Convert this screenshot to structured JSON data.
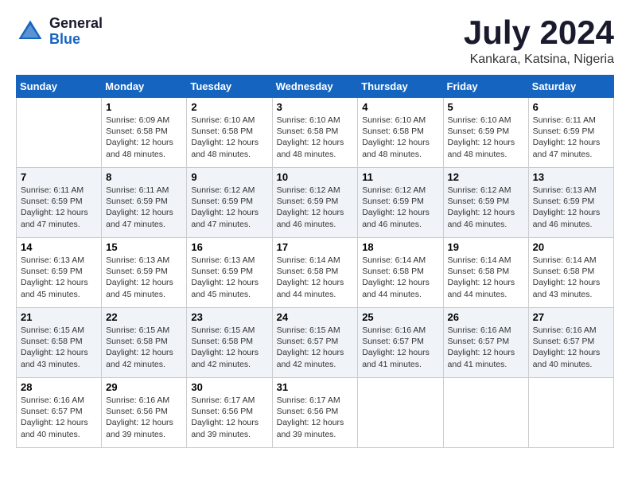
{
  "header": {
    "logo_general": "General",
    "logo_blue": "Blue",
    "month_title": "July 2024",
    "location": "Kankara, Katsina, Nigeria"
  },
  "days_of_week": [
    "Sunday",
    "Monday",
    "Tuesday",
    "Wednesday",
    "Thursday",
    "Friday",
    "Saturday"
  ],
  "weeks": [
    [
      {
        "num": "",
        "info": ""
      },
      {
        "num": "1",
        "info": "Sunrise: 6:09 AM\nSunset: 6:58 PM\nDaylight: 12 hours\nand 48 minutes."
      },
      {
        "num": "2",
        "info": "Sunrise: 6:10 AM\nSunset: 6:58 PM\nDaylight: 12 hours\nand 48 minutes."
      },
      {
        "num": "3",
        "info": "Sunrise: 6:10 AM\nSunset: 6:58 PM\nDaylight: 12 hours\nand 48 minutes."
      },
      {
        "num": "4",
        "info": "Sunrise: 6:10 AM\nSunset: 6:58 PM\nDaylight: 12 hours\nand 48 minutes."
      },
      {
        "num": "5",
        "info": "Sunrise: 6:10 AM\nSunset: 6:59 PM\nDaylight: 12 hours\nand 48 minutes."
      },
      {
        "num": "6",
        "info": "Sunrise: 6:11 AM\nSunset: 6:59 PM\nDaylight: 12 hours\nand 47 minutes."
      }
    ],
    [
      {
        "num": "7",
        "info": "Sunrise: 6:11 AM\nSunset: 6:59 PM\nDaylight: 12 hours\nand 47 minutes."
      },
      {
        "num": "8",
        "info": "Sunrise: 6:11 AM\nSunset: 6:59 PM\nDaylight: 12 hours\nand 47 minutes."
      },
      {
        "num": "9",
        "info": "Sunrise: 6:12 AM\nSunset: 6:59 PM\nDaylight: 12 hours\nand 47 minutes."
      },
      {
        "num": "10",
        "info": "Sunrise: 6:12 AM\nSunset: 6:59 PM\nDaylight: 12 hours\nand 46 minutes."
      },
      {
        "num": "11",
        "info": "Sunrise: 6:12 AM\nSunset: 6:59 PM\nDaylight: 12 hours\nand 46 minutes."
      },
      {
        "num": "12",
        "info": "Sunrise: 6:12 AM\nSunset: 6:59 PM\nDaylight: 12 hours\nand 46 minutes."
      },
      {
        "num": "13",
        "info": "Sunrise: 6:13 AM\nSunset: 6:59 PM\nDaylight: 12 hours\nand 46 minutes."
      }
    ],
    [
      {
        "num": "14",
        "info": "Sunrise: 6:13 AM\nSunset: 6:59 PM\nDaylight: 12 hours\nand 45 minutes."
      },
      {
        "num": "15",
        "info": "Sunrise: 6:13 AM\nSunset: 6:59 PM\nDaylight: 12 hours\nand 45 minutes."
      },
      {
        "num": "16",
        "info": "Sunrise: 6:13 AM\nSunset: 6:59 PM\nDaylight: 12 hours\nand 45 minutes."
      },
      {
        "num": "17",
        "info": "Sunrise: 6:14 AM\nSunset: 6:58 PM\nDaylight: 12 hours\nand 44 minutes."
      },
      {
        "num": "18",
        "info": "Sunrise: 6:14 AM\nSunset: 6:58 PM\nDaylight: 12 hours\nand 44 minutes."
      },
      {
        "num": "19",
        "info": "Sunrise: 6:14 AM\nSunset: 6:58 PM\nDaylight: 12 hours\nand 44 minutes."
      },
      {
        "num": "20",
        "info": "Sunrise: 6:14 AM\nSunset: 6:58 PM\nDaylight: 12 hours\nand 43 minutes."
      }
    ],
    [
      {
        "num": "21",
        "info": "Sunrise: 6:15 AM\nSunset: 6:58 PM\nDaylight: 12 hours\nand 43 minutes."
      },
      {
        "num": "22",
        "info": "Sunrise: 6:15 AM\nSunset: 6:58 PM\nDaylight: 12 hours\nand 42 minutes."
      },
      {
        "num": "23",
        "info": "Sunrise: 6:15 AM\nSunset: 6:58 PM\nDaylight: 12 hours\nand 42 minutes."
      },
      {
        "num": "24",
        "info": "Sunrise: 6:15 AM\nSunset: 6:57 PM\nDaylight: 12 hours\nand 42 minutes."
      },
      {
        "num": "25",
        "info": "Sunrise: 6:16 AM\nSunset: 6:57 PM\nDaylight: 12 hours\nand 41 minutes."
      },
      {
        "num": "26",
        "info": "Sunrise: 6:16 AM\nSunset: 6:57 PM\nDaylight: 12 hours\nand 41 minutes."
      },
      {
        "num": "27",
        "info": "Sunrise: 6:16 AM\nSunset: 6:57 PM\nDaylight: 12 hours\nand 40 minutes."
      }
    ],
    [
      {
        "num": "28",
        "info": "Sunrise: 6:16 AM\nSunset: 6:57 PM\nDaylight: 12 hours\nand 40 minutes."
      },
      {
        "num": "29",
        "info": "Sunrise: 6:16 AM\nSunset: 6:56 PM\nDaylight: 12 hours\nand 39 minutes."
      },
      {
        "num": "30",
        "info": "Sunrise: 6:17 AM\nSunset: 6:56 PM\nDaylight: 12 hours\nand 39 minutes."
      },
      {
        "num": "31",
        "info": "Sunrise: 6:17 AM\nSunset: 6:56 PM\nDaylight: 12 hours\nand 39 minutes."
      },
      {
        "num": "",
        "info": ""
      },
      {
        "num": "",
        "info": ""
      },
      {
        "num": "",
        "info": ""
      }
    ]
  ]
}
